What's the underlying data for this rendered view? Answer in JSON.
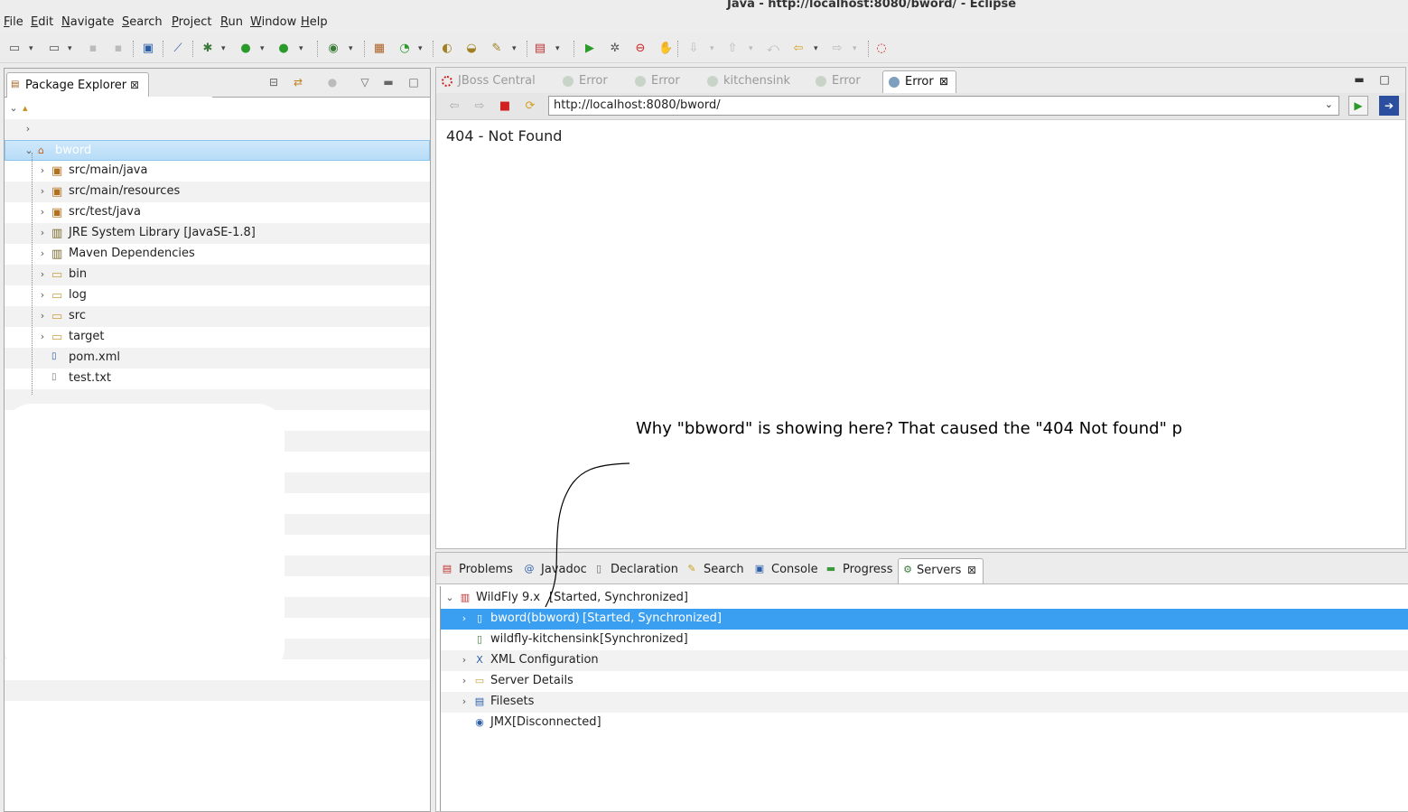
{
  "window": {
    "title": "Java - http://localhost:8080/bword/ - Eclipse"
  },
  "menu": [
    {
      "accel": "F",
      "rest": "ile"
    },
    {
      "accel": "E",
      "rest": "dit"
    },
    {
      "accel": "N",
      "rest": "avigate"
    },
    {
      "accel": "S",
      "rest": "earch"
    },
    {
      "accel": "P",
      "rest": "roject"
    },
    {
      "accel": "R",
      "rest": "un"
    },
    {
      "accel": "W",
      "rest": "indow"
    },
    {
      "accel": "H",
      "rest": "elp"
    }
  ],
  "package_explorer": {
    "tab_label": "Package Explorer",
    "items": [
      {
        "label": "bword",
        "icon": "project-icon"
      },
      {
        "label": "src/main/java",
        "icon": "source-folder-icon"
      },
      {
        "label": "src/main/resources",
        "icon": "source-folder-icon"
      },
      {
        "label": "src/test/java",
        "icon": "source-folder-icon"
      },
      {
        "label": "JRE System Library [JavaSE-1.8]",
        "icon": "library-icon"
      },
      {
        "label": "Maven Dependencies",
        "icon": "library-icon"
      },
      {
        "label": "bin",
        "icon": "folder-icon"
      },
      {
        "label": "log",
        "icon": "folder-icon"
      },
      {
        "label": "src",
        "icon": "folder-icon"
      },
      {
        "label": "target",
        "icon": "folder-icon"
      },
      {
        "label": "pom.xml",
        "icon": "maven-file-icon"
      },
      {
        "label": "test.txt",
        "icon": "text-file-icon"
      }
    ]
  },
  "browser": {
    "tabs": [
      {
        "label": "JBoss Central"
      },
      {
        "label": "Error"
      },
      {
        "label": "Error"
      },
      {
        "label": "kitchensink"
      },
      {
        "label": "Error"
      },
      {
        "label": "Error"
      }
    ],
    "url": "http://localhost:8080/bword/",
    "page_text": "404 - Not Found"
  },
  "annotation": {
    "text": "Why \"bbword\" is showing here? That caused the \"404 Not found\" p"
  },
  "bottom_views": {
    "tabs": [
      {
        "label": "Problems"
      },
      {
        "label": "Javadoc"
      },
      {
        "label": "Declaration"
      },
      {
        "label": "Search"
      },
      {
        "label": "Console"
      },
      {
        "label": "Progress"
      },
      {
        "label": "Servers"
      }
    ],
    "servers": [
      {
        "name": "WildFly  9.x",
        "status": "[Started, Synchronized]"
      },
      {
        "name": "bword(bbword)",
        "status": "[Started, Synchronized]"
      },
      {
        "name": "wildfly-kitchensink",
        "status": "[Synchronized]"
      },
      {
        "name": "XML Configuration",
        "status": ""
      },
      {
        "name": "Server Details",
        "status": ""
      },
      {
        "name": "Filesets",
        "status": ""
      },
      {
        "name": "JMX[Disconnected]",
        "status": ""
      }
    ]
  },
  "colors": {
    "selection": "#3a9ff0",
    "tree_selection": "#b7dcf7",
    "run_green": "#2a9a2a",
    "stop_red": "#d02020"
  }
}
